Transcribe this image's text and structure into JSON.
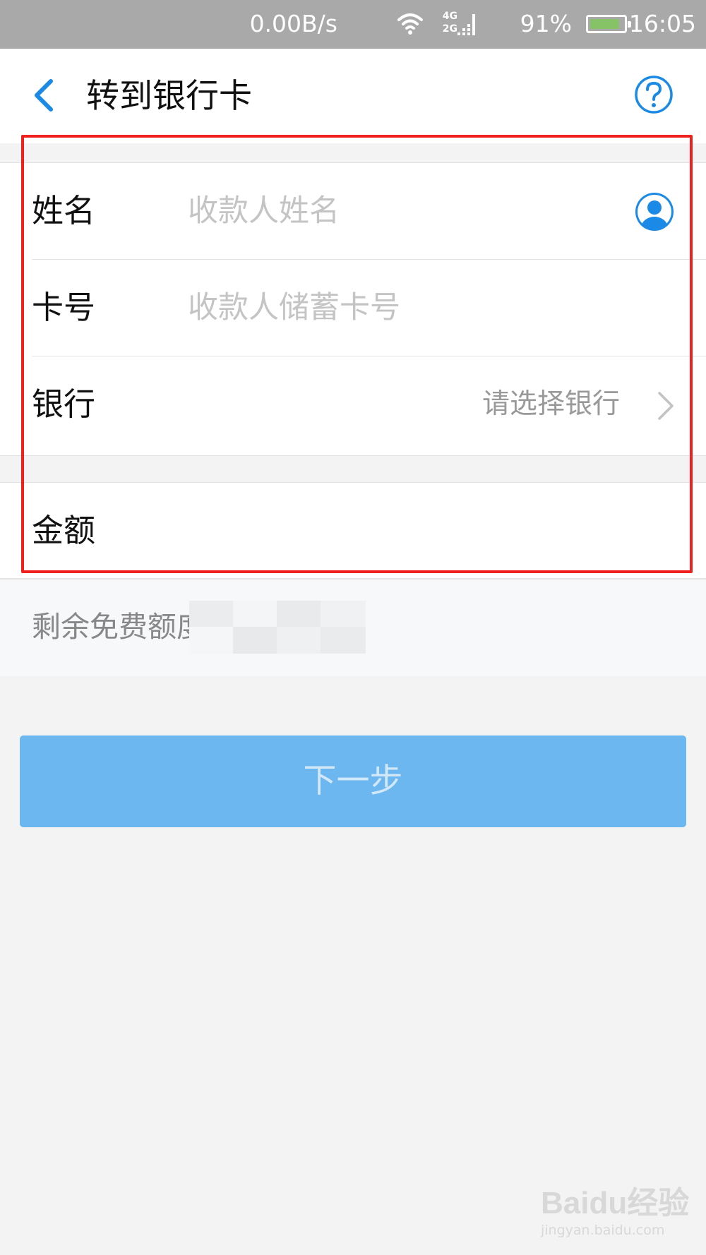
{
  "status_bar": {
    "network_speed": "0.00B/s",
    "signal_labels": [
      "4G",
      "2G"
    ],
    "battery": "91%",
    "battery_level": 0.91,
    "time": "16:05"
  },
  "nav": {
    "back_icon": "chevron-left-icon",
    "title": "转到银行卡",
    "help_icon": "question-circle-icon"
  },
  "form": {
    "name": {
      "label": "姓名",
      "placeholder": "收款人姓名",
      "value": "",
      "contact_icon": "contact-person-icon"
    },
    "card": {
      "label": "卡号",
      "placeholder": "收款人储蓄卡号",
      "value": ""
    },
    "bank": {
      "label": "银行",
      "value": "请选择银行",
      "chevron_icon": "chevron-right-icon"
    },
    "amount": {
      "label": "金额",
      "value": ""
    }
  },
  "quota": {
    "label": "剩余免费额度"
  },
  "next_button": {
    "label": "下一步"
  },
  "watermark": {
    "logo": "Baidu经验",
    "url": "jingyan.baidu.com"
  },
  "colors": {
    "accent": "#1b8ae6",
    "button_bg": "#6cb7ef",
    "button_text": "#d2e8f9",
    "highlight": "#f0201e",
    "status_bar": "#a9a9a9",
    "page_bg": "#f3f3f3"
  }
}
